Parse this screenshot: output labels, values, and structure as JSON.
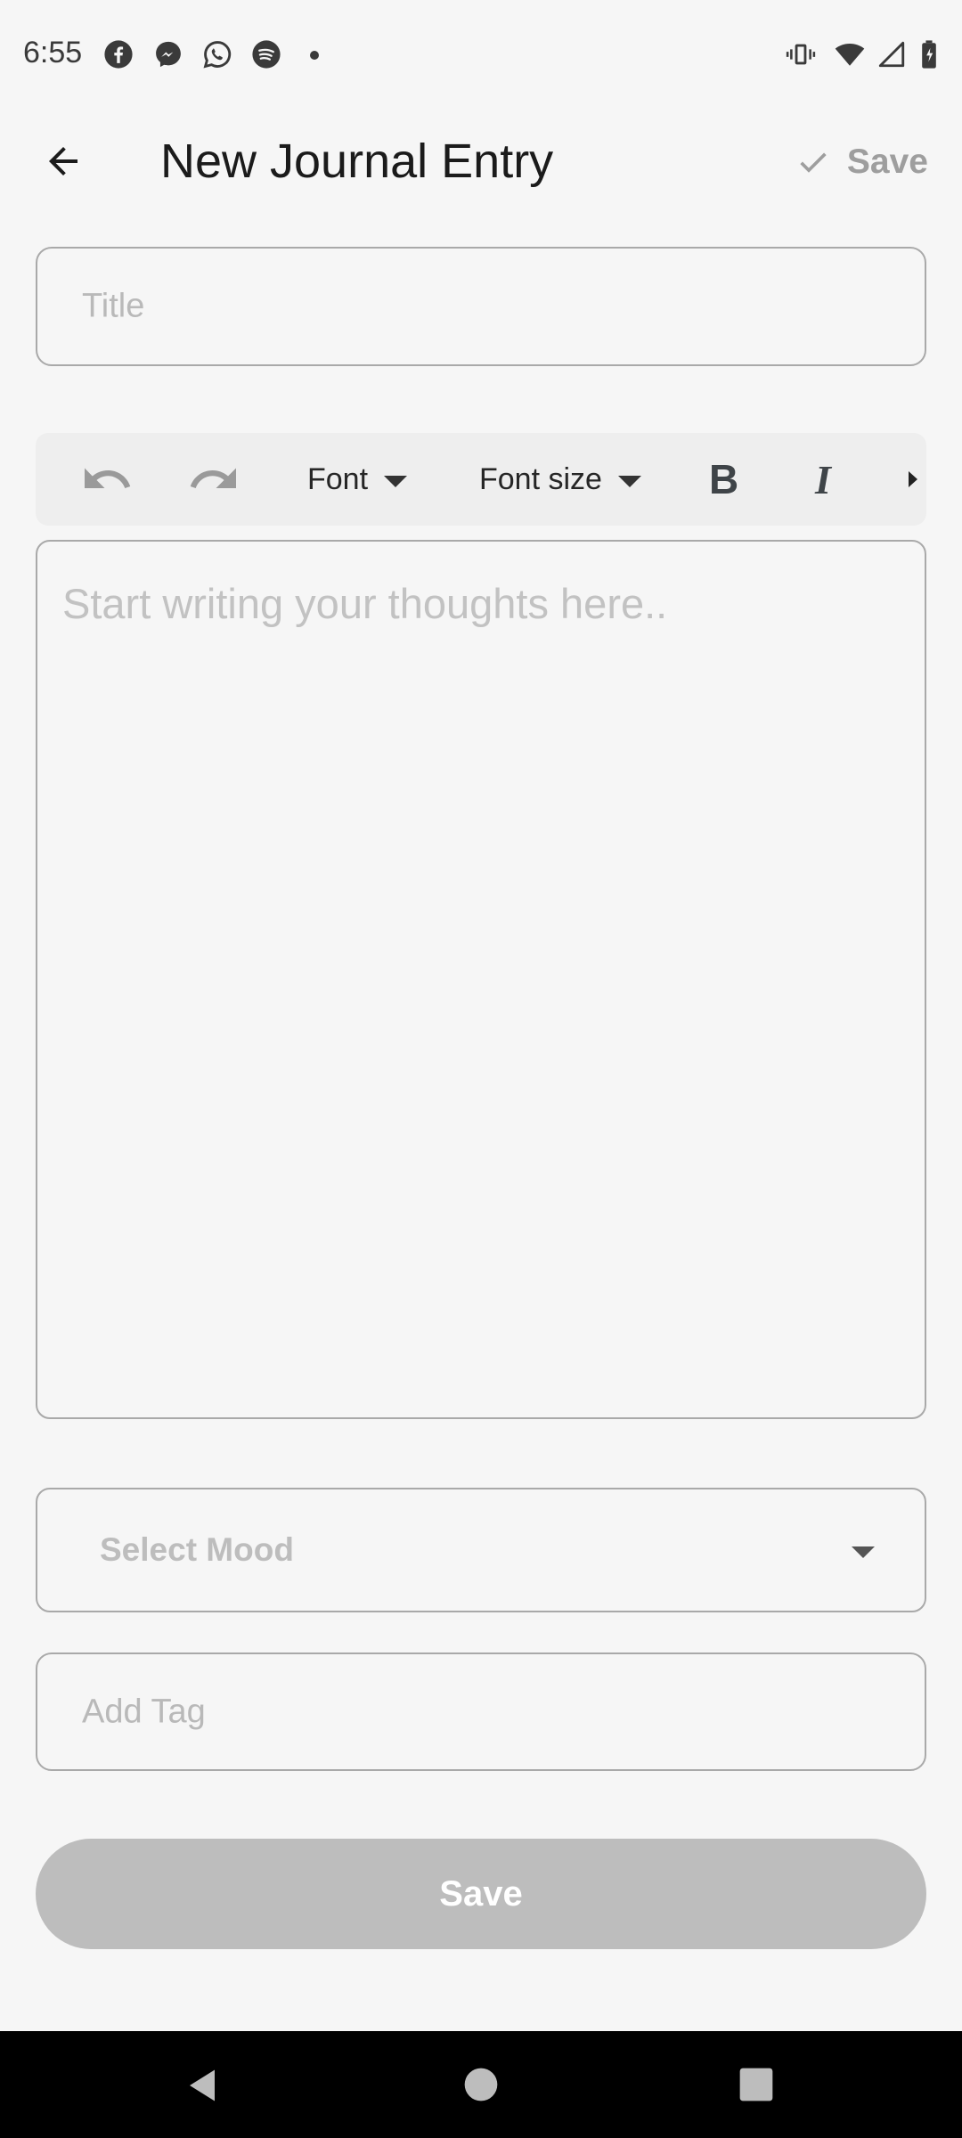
{
  "status_bar": {
    "time": "6:55",
    "notification_icons": [
      "facebook-icon",
      "messenger-icon",
      "whatsapp-icon",
      "spotify-icon"
    ],
    "system_icons": [
      "vibrate-icon",
      "wifi-icon",
      "signal-icon",
      "battery-icon"
    ]
  },
  "app_bar": {
    "title": "New Journal Entry",
    "back_icon": "arrow-back-icon",
    "save_label": "Save",
    "save_icon": "check-icon"
  },
  "title_field": {
    "placeholder": "Title",
    "value": ""
  },
  "toolbar": {
    "undo_icon": "undo-icon",
    "redo_icon": "redo-icon",
    "font_label": "Font",
    "font_size_label": "Font size",
    "bold_label": "B",
    "italic_label": "I",
    "more_icon": "more-right-icon"
  },
  "editor": {
    "placeholder": "Start writing your thoughts here..",
    "value": ""
  },
  "mood_select": {
    "placeholder": "Select Mood",
    "icon": "dropdown-arrow-icon"
  },
  "tag_field": {
    "placeholder": "Add Tag",
    "value": ""
  },
  "save_button": {
    "label": "Save"
  },
  "colors": {
    "background": "#f6f6f6",
    "border": "#a9a9a9",
    "disabled_button": "#bdbdbd",
    "placeholder": "#b9b9b9",
    "nav_bar": "#000000"
  }
}
